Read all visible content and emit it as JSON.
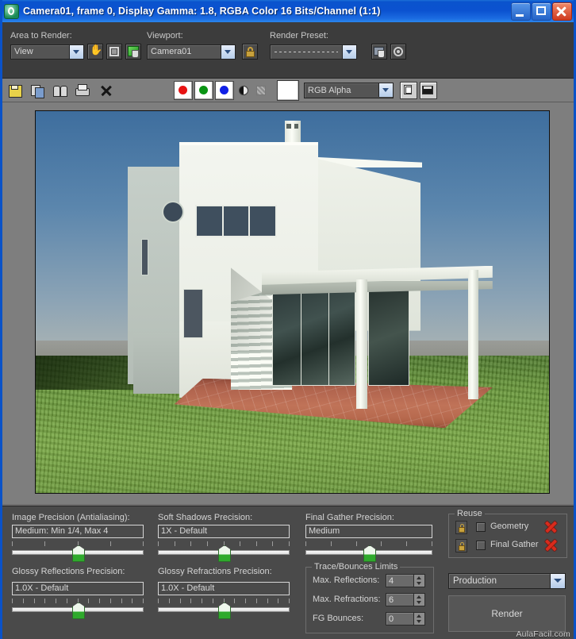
{
  "window": {
    "title": "Camera01, frame 0, Display Gamma: 1.8, RGBA Color 16 Bits/Channel (1:1)",
    "app_icon": "render-window-icon",
    "minimize_label": "Minimize",
    "maximize_label": "Maximize",
    "close_label": "Close"
  },
  "toolbar": {
    "area_to_render": {
      "label": "Area to Render:",
      "value": "View",
      "buttons": [
        "pan-hand-icon",
        "region-icon",
        "auto-region-icon"
      ]
    },
    "viewport": {
      "label": "Viewport:",
      "value": "Camera01",
      "lock_icon": "lock-icon"
    },
    "render_preset": {
      "label": "Render Preset:",
      "value": "",
      "buttons": [
        "load-preset-icon",
        "render-setup-icon"
      ]
    }
  },
  "image_toolbar": {
    "buttons": [
      {
        "name": "save-bitmap",
        "icon": "floppy-disk-icon"
      },
      {
        "name": "copy-bitmap",
        "icon": "copy-icon"
      },
      {
        "name": "clone-bitmap",
        "icon": "clone-icon"
      },
      {
        "name": "print-bitmap",
        "icon": "printer-icon"
      },
      {
        "name": "clear-bitmap",
        "icon": "close-x-icon"
      }
    ],
    "channels": [
      {
        "name": "red-channel",
        "color": "#e81414"
      },
      {
        "name": "green-channel",
        "color": "#0a9414"
      },
      {
        "name": "blue-channel",
        "color": "#1020e6"
      },
      {
        "name": "alpha-channel",
        "color": "#111111"
      },
      {
        "name": "mono-channel",
        "color": "#9b9b9b"
      }
    ],
    "color_swatch": "#ffffff",
    "channel_display": "RGB Alpha",
    "view_buttons": [
      {
        "name": "toggle-ui-overlay",
        "icon": "duplicate-frame-icon"
      },
      {
        "name": "toggle-image-info",
        "icon": "image-strip-icon"
      }
    ]
  },
  "render_view": {
    "name": "rendered-image",
    "description": "Rendered 3D exterior of a modern white two-storey house with flat roof, chimney, porthole window, strip window, pergola carport with two columns, terracotta tiled patio, glass sliding doors, green lawn and blue sky"
  },
  "settings": {
    "image_precision": {
      "label": "Image Precision (Antialiasing):",
      "value": "Medium: Min 1/4, Max 4",
      "ticks": 5,
      "position": 50
    },
    "soft_shadows": {
      "label": "Soft Shadows Precision:",
      "value": "1X - Default",
      "ticks": 9,
      "position": 50
    },
    "final_gather": {
      "label": "Final Gather Precision:",
      "value": "Medium",
      "ticks": 6,
      "position": 50
    },
    "glossy_reflections": {
      "label": "Glossy Reflections Precision:",
      "value": "1.0X - Default",
      "ticks": 13,
      "position": 50
    },
    "glossy_refractions": {
      "label": "Glossy Refractions Precision:",
      "value": "1.0X - Default",
      "ticks": 13,
      "position": 50
    },
    "trace_bounces": {
      "title": "Trace/Bounces Limits",
      "fields": [
        {
          "label": "Max. Reflections:",
          "value": "4"
        },
        {
          "label": "Max. Refractions:",
          "value": "6"
        },
        {
          "label": "FG Bounces:",
          "value": "0"
        }
      ]
    },
    "reuse": {
      "title": "Reuse",
      "rows": [
        {
          "label": "Geometry",
          "checked": false,
          "lock": "lock-icon",
          "clear": "clear-x-icon"
        },
        {
          "label": "Final Gather",
          "checked": false,
          "lock": "lock-icon",
          "clear": "clear-x-icon"
        }
      ]
    },
    "render_mode": "Production",
    "render_button": "Render"
  },
  "watermark": {
    "brand": "AulaFacil",
    "suffix": ".com"
  }
}
